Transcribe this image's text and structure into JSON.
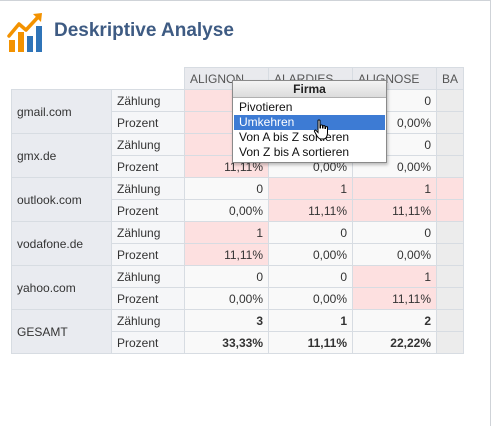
{
  "header": {
    "title": "Deskriptive Analyse",
    "logo_icon": "bar-chart-growth-icon",
    "logo_colors": [
      "#f39200",
      "#2f74b8"
    ]
  },
  "columns": [
    "ALIGNON",
    "ALARDIES",
    "ALIGNOSE",
    "BA"
  ],
  "rows": [
    {
      "label": "gmail.com",
      "counts": [
        "",
        "",
        "0",
        ""
      ],
      "percents": [
        "11",
        "",
        "0,00%",
        ""
      ],
      "highlight": [
        true,
        false,
        false,
        false
      ]
    },
    {
      "label": "gmx.de",
      "counts": [
        "",
        "",
        "0",
        ""
      ],
      "percents": [
        "11,11%",
        "0,00%",
        "0,00%",
        ""
      ],
      "highlight": [
        true,
        false,
        false,
        false
      ]
    },
    {
      "label": "outlook.com",
      "counts": [
        "0",
        "1",
        "1",
        ""
      ],
      "percents": [
        "0,00%",
        "11,11%",
        "11,11%",
        ""
      ],
      "highlight": [
        false,
        true,
        true,
        true
      ]
    },
    {
      "label": "vodafone.de",
      "counts": [
        "1",
        "0",
        "0",
        ""
      ],
      "percents": [
        "11,11%",
        "0,00%",
        "0,00%",
        ""
      ],
      "highlight": [
        true,
        false,
        false,
        false
      ]
    },
    {
      "label": "yahoo.com",
      "counts": [
        "0",
        "0",
        "1",
        ""
      ],
      "percents": [
        "0,00%",
        "0,00%",
        "11,11%",
        ""
      ],
      "highlight": [
        false,
        false,
        true,
        false
      ]
    },
    {
      "label": "GESAMT",
      "counts": [
        "3",
        "1",
        "2",
        ""
      ],
      "percents": [
        "33,33%",
        "11,11%",
        "22,22%",
        ""
      ],
      "highlight": [
        false,
        false,
        false,
        false
      ],
      "total": true
    }
  ],
  "sub_labels": {
    "count": "Zählung",
    "percent": "Prozent"
  },
  "dropdown": {
    "title": "Firma",
    "items": [
      "Pivotieren",
      "Umkehren",
      "Von A bis Z sortieren",
      "Von Z bis A sortieren"
    ],
    "active_index": 1
  },
  "colors": {
    "highlight": "#fde0e0",
    "selected": "#3d7bd4",
    "title": "#3e5b83"
  }
}
